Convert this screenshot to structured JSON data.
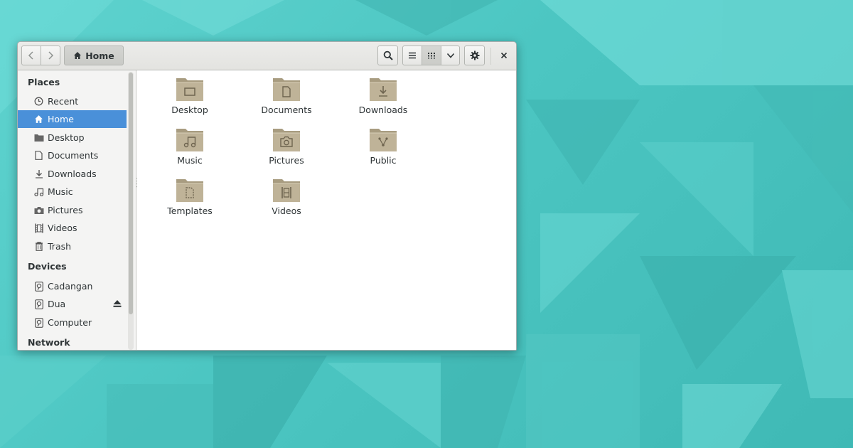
{
  "window": {
    "path_label": "Home"
  },
  "toolbar": {
    "back": "back",
    "forward": "forward",
    "search": "search-icon",
    "list_view": "list-view-icon",
    "grid_view": "grid-view-icon",
    "view_menu": "chevron-down-icon",
    "settings": "gear-icon",
    "close": "close-icon"
  },
  "sidebar": {
    "places_heading": "Places",
    "devices_heading": "Devices",
    "network_heading": "Network",
    "places": [
      {
        "label": "Recent",
        "icon": "clock-icon"
      },
      {
        "label": "Home",
        "icon": "home-icon",
        "selected": true
      },
      {
        "label": "Desktop",
        "icon": "folder-icon"
      },
      {
        "label": "Documents",
        "icon": "document-icon"
      },
      {
        "label": "Downloads",
        "icon": "download-icon"
      },
      {
        "label": "Music",
        "icon": "music-icon"
      },
      {
        "label": "Pictures",
        "icon": "camera-icon"
      },
      {
        "label": "Videos",
        "icon": "film-icon"
      },
      {
        "label": "Trash",
        "icon": "trash-icon"
      }
    ],
    "devices": [
      {
        "label": "Cadangan",
        "icon": "drive-icon"
      },
      {
        "label": "Dua",
        "icon": "drive-icon",
        "ejectable": true
      },
      {
        "label": "Computer",
        "icon": "drive-icon"
      }
    ]
  },
  "files": [
    {
      "label": "Desktop",
      "icon": "desktop-folder-icon"
    },
    {
      "label": "Documents",
      "icon": "documents-folder-icon"
    },
    {
      "label": "Downloads",
      "icon": "downloads-folder-icon"
    },
    {
      "label": "Music",
      "icon": "music-folder-icon"
    },
    {
      "label": "Pictures",
      "icon": "pictures-folder-icon"
    },
    {
      "label": "Public",
      "icon": "public-folder-icon"
    },
    {
      "label": "Templates",
      "icon": "templates-folder-icon"
    },
    {
      "label": "Videos",
      "icon": "videos-folder-icon"
    }
  ],
  "colors": {
    "selection": "#4a90d9",
    "folder": "#b3a78c",
    "wallpaper": "#4cc6c2"
  }
}
